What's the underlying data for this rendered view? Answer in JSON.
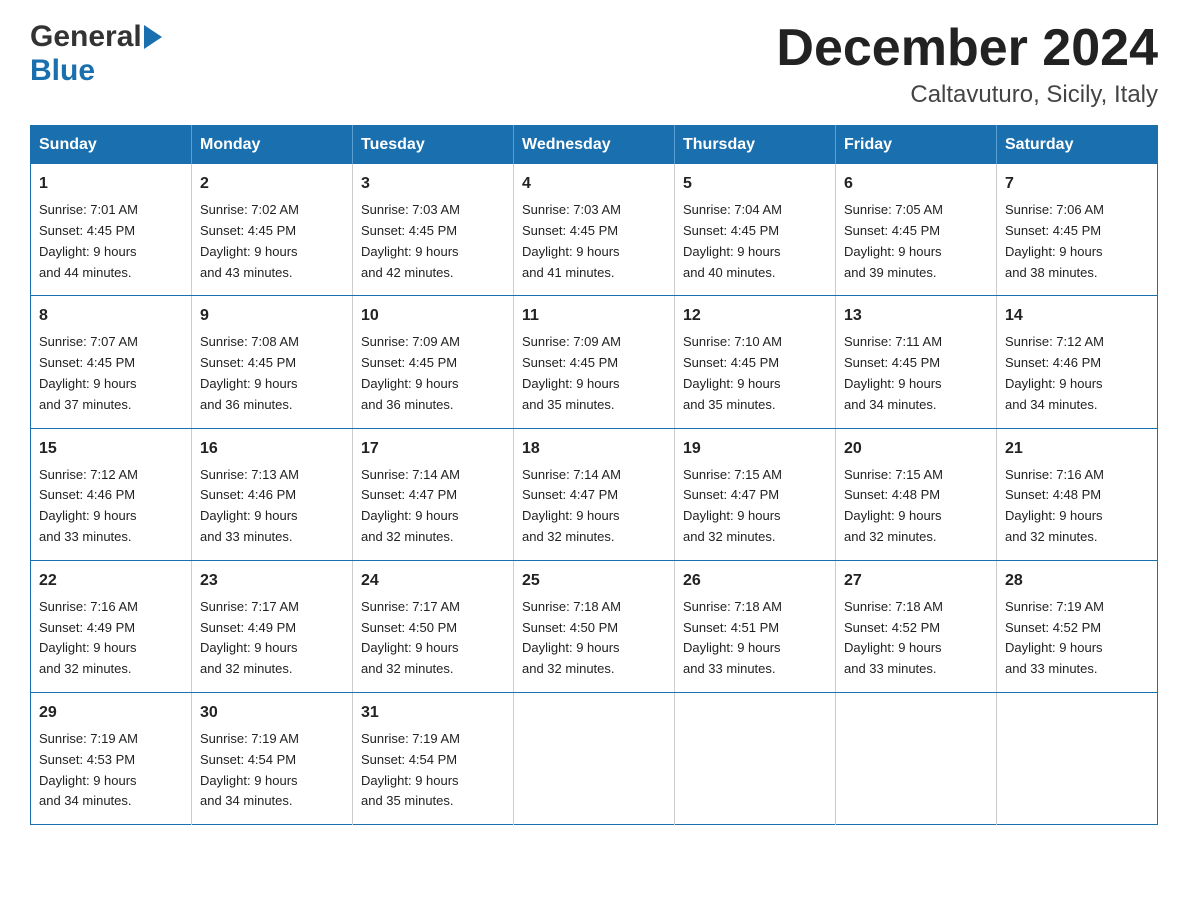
{
  "header": {
    "logo_general": "General",
    "logo_blue": "Blue",
    "month_title": "December 2024",
    "location": "Caltavuturo, Sicily, Italy"
  },
  "weekdays": [
    "Sunday",
    "Monday",
    "Tuesday",
    "Wednesday",
    "Thursday",
    "Friday",
    "Saturday"
  ],
  "weeks": [
    [
      {
        "day": "1",
        "sunrise": "7:01 AM",
        "sunset": "4:45 PM",
        "daylight": "9 hours and 44 minutes."
      },
      {
        "day": "2",
        "sunrise": "7:02 AM",
        "sunset": "4:45 PM",
        "daylight": "9 hours and 43 minutes."
      },
      {
        "day": "3",
        "sunrise": "7:03 AM",
        "sunset": "4:45 PM",
        "daylight": "9 hours and 42 minutes."
      },
      {
        "day": "4",
        "sunrise": "7:03 AM",
        "sunset": "4:45 PM",
        "daylight": "9 hours and 41 minutes."
      },
      {
        "day": "5",
        "sunrise": "7:04 AM",
        "sunset": "4:45 PM",
        "daylight": "9 hours and 40 minutes."
      },
      {
        "day": "6",
        "sunrise": "7:05 AM",
        "sunset": "4:45 PM",
        "daylight": "9 hours and 39 minutes."
      },
      {
        "day": "7",
        "sunrise": "7:06 AM",
        "sunset": "4:45 PM",
        "daylight": "9 hours and 38 minutes."
      }
    ],
    [
      {
        "day": "8",
        "sunrise": "7:07 AM",
        "sunset": "4:45 PM",
        "daylight": "9 hours and 37 minutes."
      },
      {
        "day": "9",
        "sunrise": "7:08 AM",
        "sunset": "4:45 PM",
        "daylight": "9 hours and 36 minutes."
      },
      {
        "day": "10",
        "sunrise": "7:09 AM",
        "sunset": "4:45 PM",
        "daylight": "9 hours and 36 minutes."
      },
      {
        "day": "11",
        "sunrise": "7:09 AM",
        "sunset": "4:45 PM",
        "daylight": "9 hours and 35 minutes."
      },
      {
        "day": "12",
        "sunrise": "7:10 AM",
        "sunset": "4:45 PM",
        "daylight": "9 hours and 35 minutes."
      },
      {
        "day": "13",
        "sunrise": "7:11 AM",
        "sunset": "4:45 PM",
        "daylight": "9 hours and 34 minutes."
      },
      {
        "day": "14",
        "sunrise": "7:12 AM",
        "sunset": "4:46 PM",
        "daylight": "9 hours and 34 minutes."
      }
    ],
    [
      {
        "day": "15",
        "sunrise": "7:12 AM",
        "sunset": "4:46 PM",
        "daylight": "9 hours and 33 minutes."
      },
      {
        "day": "16",
        "sunrise": "7:13 AM",
        "sunset": "4:46 PM",
        "daylight": "9 hours and 33 minutes."
      },
      {
        "day": "17",
        "sunrise": "7:14 AM",
        "sunset": "4:47 PM",
        "daylight": "9 hours and 32 minutes."
      },
      {
        "day": "18",
        "sunrise": "7:14 AM",
        "sunset": "4:47 PM",
        "daylight": "9 hours and 32 minutes."
      },
      {
        "day": "19",
        "sunrise": "7:15 AM",
        "sunset": "4:47 PM",
        "daylight": "9 hours and 32 minutes."
      },
      {
        "day": "20",
        "sunrise": "7:15 AM",
        "sunset": "4:48 PM",
        "daylight": "9 hours and 32 minutes."
      },
      {
        "day": "21",
        "sunrise": "7:16 AM",
        "sunset": "4:48 PM",
        "daylight": "9 hours and 32 minutes."
      }
    ],
    [
      {
        "day": "22",
        "sunrise": "7:16 AM",
        "sunset": "4:49 PM",
        "daylight": "9 hours and 32 minutes."
      },
      {
        "day": "23",
        "sunrise": "7:17 AM",
        "sunset": "4:49 PM",
        "daylight": "9 hours and 32 minutes."
      },
      {
        "day": "24",
        "sunrise": "7:17 AM",
        "sunset": "4:50 PM",
        "daylight": "9 hours and 32 minutes."
      },
      {
        "day": "25",
        "sunrise": "7:18 AM",
        "sunset": "4:50 PM",
        "daylight": "9 hours and 32 minutes."
      },
      {
        "day": "26",
        "sunrise": "7:18 AM",
        "sunset": "4:51 PM",
        "daylight": "9 hours and 33 minutes."
      },
      {
        "day": "27",
        "sunrise": "7:18 AM",
        "sunset": "4:52 PM",
        "daylight": "9 hours and 33 minutes."
      },
      {
        "day": "28",
        "sunrise": "7:19 AM",
        "sunset": "4:52 PM",
        "daylight": "9 hours and 33 minutes."
      }
    ],
    [
      {
        "day": "29",
        "sunrise": "7:19 AM",
        "sunset": "4:53 PM",
        "daylight": "9 hours and 34 minutes."
      },
      {
        "day": "30",
        "sunrise": "7:19 AM",
        "sunset": "4:54 PM",
        "daylight": "9 hours and 34 minutes."
      },
      {
        "day": "31",
        "sunrise": "7:19 AM",
        "sunset": "4:54 PM",
        "daylight": "9 hours and 35 minutes."
      },
      null,
      null,
      null,
      null
    ]
  ],
  "labels": {
    "sunrise": "Sunrise:",
    "sunset": "Sunset:",
    "daylight": "Daylight:"
  }
}
